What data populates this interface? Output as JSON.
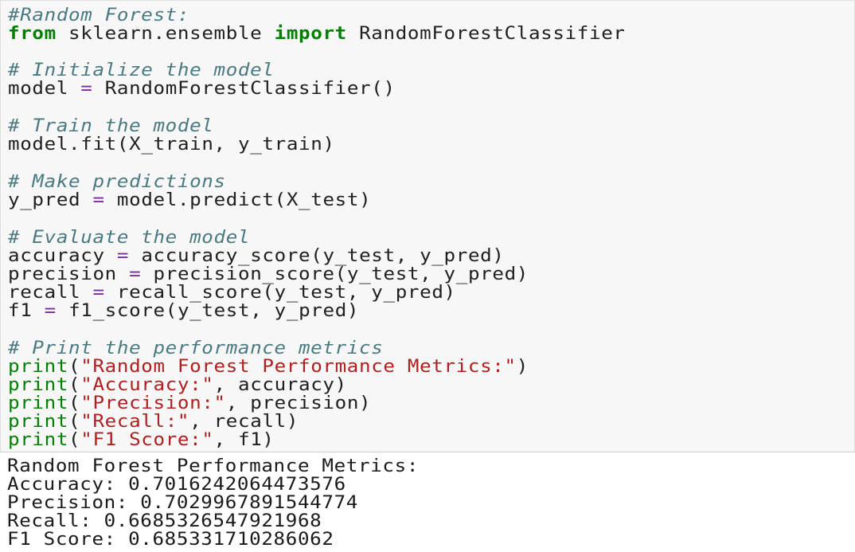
{
  "notebook": {
    "code_lines": [
      "#Random Forest:",
      "from sklearn.ensemble import RandomForestClassifier",
      "# Initialize the model",
      "model = RandomForestClassifier()",
      "# Train the model",
      "model.fit(X_train, y_train)",
      "# Make predictions",
      "y_pred = model.predict(X_test)",
      "# Evaluate the model",
      "accuracy = accuracy_score(y_test, y_pred)",
      "precision = precision_score(y_test, y_pred)",
      "recall = recall_score(y_test, y_pred)",
      "f1 = f1_score(y_test, y_pred)",
      "# Print the performance metrics",
      "print(\"Random Forest Performance Metrics:\")",
      "print(\"Accuracy:\", accuracy)",
      "print(\"Precision:\", precision)",
      "print(\"Recall:\", recall)",
      "print(\"F1 Score:\", f1)"
    ],
    "output_lines": [
      "Random Forest Performance Metrics:",
      "Accuracy: 0.7016242064473576",
      "Precision: 0.7029967891544774",
      "Recall: 0.6685326547921968",
      "F1 Score: 0.685331710286062"
    ]
  },
  "colors": {
    "comment": "#4a7a80",
    "keyword": "#008000",
    "operator": "#7a2d9a",
    "string": "#b01f1f",
    "text": "#202020",
    "cell_background": "#f7f7f7"
  }
}
